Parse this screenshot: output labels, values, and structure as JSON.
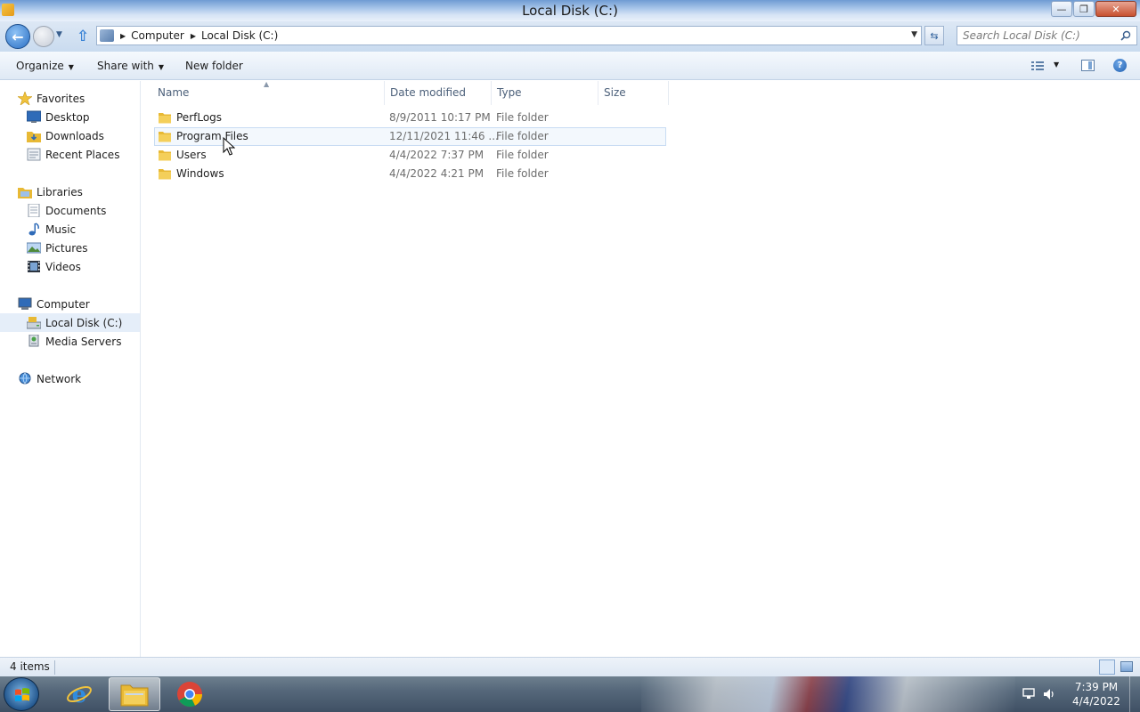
{
  "window": {
    "title": "Local Disk (C:)",
    "min_label": "—",
    "max_label": "❐",
    "close_label": "✕"
  },
  "address": {
    "crumbs": [
      "Computer",
      "Local Disk (C:)"
    ],
    "search_placeholder": "Search Local Disk (C:)"
  },
  "toolbar": {
    "organize": "Organize",
    "share_with": "Share with",
    "new_folder": "New folder"
  },
  "navpane": {
    "favorites": "Favorites",
    "favorites_items": [
      "Desktop",
      "Downloads",
      "Recent Places"
    ],
    "libraries": "Libraries",
    "libraries_items": [
      "Documents",
      "Music",
      "Pictures",
      "Videos"
    ],
    "computer": "Computer",
    "computer_items": [
      "Local Disk (C:)",
      "Media Servers"
    ],
    "network": "Network",
    "selected": "Local Disk (C:)"
  },
  "columns": {
    "name": "Name",
    "date": "Date modified",
    "type": "Type",
    "size": "Size"
  },
  "files": [
    {
      "name": "PerfLogs",
      "date": "8/9/2011 10:17 PM",
      "type": "File folder"
    },
    {
      "name": "Program Files",
      "date": "12/11/2021 11:46 ...",
      "type": "File folder"
    },
    {
      "name": "Users",
      "date": "4/4/2022 7:37 PM",
      "type": "File folder"
    },
    {
      "name": "Windows",
      "date": "4/4/2022 4:21 PM",
      "type": "File folder"
    }
  ],
  "status": {
    "count": "4 items"
  },
  "taskbar": {
    "time": "7:39 PM",
    "date": "4/4/2022"
  },
  "icons": {
    "back": "back-arrow-icon",
    "forward": "forward-arrow-icon",
    "up": "up-arrow-icon",
    "search": "search-icon",
    "folder": "folder-icon",
    "help": "help-icon"
  },
  "colors": {
    "accent": "#2a6fc4",
    "selection": "#e5eef9",
    "folder": "#e8b935"
  }
}
